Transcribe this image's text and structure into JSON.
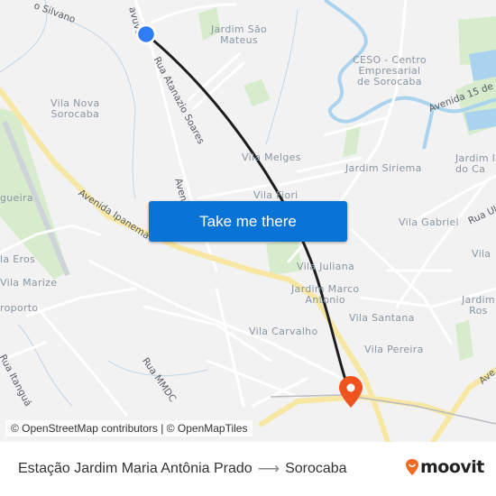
{
  "map": {
    "areas": [
      {
        "name": "Jardim São Mateus",
        "lines": [
          "Jardim São",
          "Mateus"
        ]
      },
      {
        "name": "CESO - Centro Empresarial de Sorocaba",
        "lines": [
          "CESO - Centro",
          "Empresarial",
          "de Sorocaba"
        ]
      },
      {
        "name": "Vila Nova Sorocaba",
        "lines": [
          "Vila Nova",
          "Sorocaba"
        ]
      },
      {
        "name": "Vila Melges",
        "lines": [
          "Vila Melges"
        ]
      },
      {
        "name": "Jardim Siriema",
        "lines": [
          "Jardim Siriema"
        ]
      },
      {
        "name": "Jardim do Ca...",
        "lines": [
          "Jardim I",
          "do Ca"
        ]
      },
      {
        "name": "Vila Fiori",
        "lines": [
          "Vila Fiori"
        ]
      },
      {
        "name": "Vila Gabriel",
        "lines": [
          "Vila Gabriel"
        ]
      },
      {
        "name": "Vila ...",
        "lines": [
          "Vila"
        ]
      },
      {
        "name": "...gueira",
        "lines": [
          "gueira"
        ]
      },
      {
        "name": "Vila Eros",
        "lines": [
          "la Eros"
        ]
      },
      {
        "name": "Vila Marize",
        "lines": [
          "Vila Marize"
        ]
      },
      {
        "name": "Aeroporto",
        "lines": [
          "roporto"
        ]
      },
      {
        "name": "Vila Juliana",
        "lines": [
          "Vila Juliana"
        ]
      },
      {
        "name": "Jardim Marco Antonio",
        "lines": [
          "Jardim Marco",
          "Antonio"
        ]
      },
      {
        "name": "Jardim Ros...",
        "lines": [
          "Jardim",
          "Ros"
        ]
      },
      {
        "name": "Vila Santana",
        "lines": [
          "Vila Santana"
        ]
      },
      {
        "name": "Vila Carvalho",
        "lines": [
          "Vila Carvalho"
        ]
      },
      {
        "name": "Vila Pereira",
        "lines": [
          "Vila Pereira"
        ]
      }
    ],
    "streets": [
      {
        "name": "Silvano",
        "text": "o Silvano"
      },
      {
        "name": "Avenida Itavuvu",
        "text": "avuvu"
      },
      {
        "name": "Rua Atanazio Soares",
        "text": "Rua Atanazio Soares"
      },
      {
        "name": "Avenida 15 de",
        "text": "Avenida 15 de"
      },
      {
        "name": "Avenida Ipanema",
        "text": "Avenida Ipanema"
      },
      {
        "name": "Avenida",
        "text": "Avenid"
      },
      {
        "name": "Rua Ul",
        "text": "Rua Ul"
      },
      {
        "name": "Rua Itanguá",
        "text": "Rua Itanguá"
      },
      {
        "name": "Rua MMDC",
        "text": "Rua MMDC"
      },
      {
        "name": "Ave",
        "text": "Ave"
      }
    ],
    "attribution": "© OpenStreetMap contributors | © OpenMapTiles",
    "origin_marker_color": "#2f7cf6",
    "destination_marker_color": "#f0541e",
    "route_color": "#1e1e1e"
  },
  "cta": {
    "label": "Take me there",
    "color": "#0a73d6"
  },
  "footer": {
    "origin": "Estação Jardim Maria Antônia Prado",
    "arrow": "⟶",
    "destination": "Sorocaba",
    "brand": "moovit",
    "brand_color": "#f26a21"
  }
}
